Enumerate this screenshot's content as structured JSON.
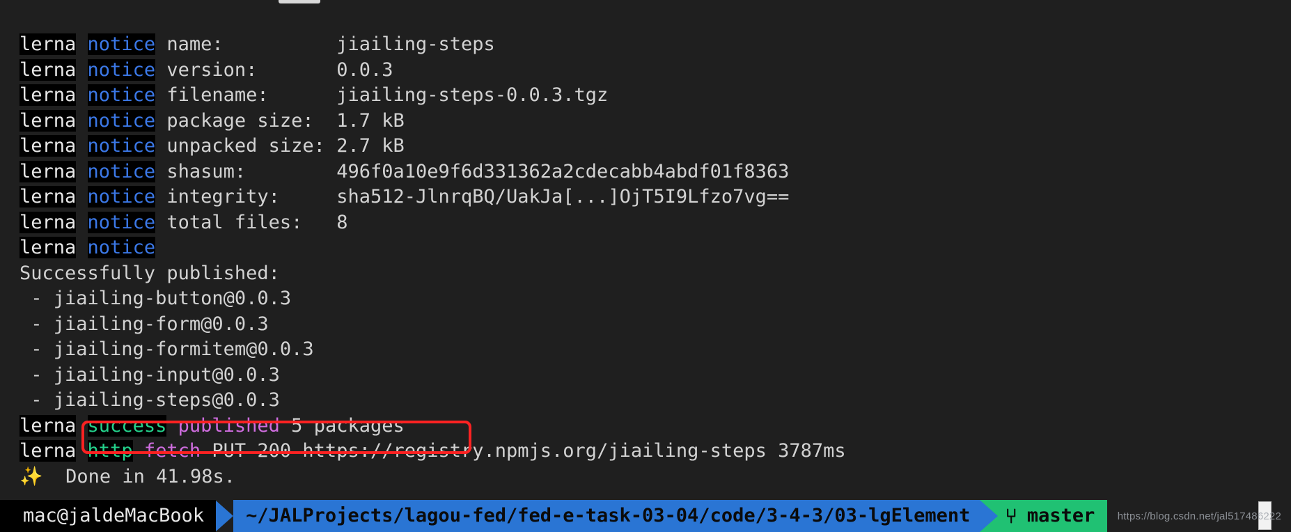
{
  "terminal": {
    "background": "#1f1f1f",
    "foreground": "#d2d2d2",
    "notice_color": "#3b78e7",
    "success_color": "#23d18b",
    "magenta_color": "#cf6ddf",
    "annotation_color": "#fb2222"
  },
  "lines": {
    "l1_tag": "lerna",
    "l1_level": "notice",
    "l1_key": " name:          ",
    "l1_value": "jiailing-steps",
    "l2_tag": "lerna",
    "l2_level": "notice",
    "l2_key": " version:       ",
    "l2_value": "0.0.3",
    "l3_tag": "lerna",
    "l3_level": "notice",
    "l3_key": " filename:      ",
    "l3_value": "jiailing-steps-0.0.3.tgz",
    "l4_tag": "lerna",
    "l4_level": "notice",
    "l4_key": " package size:  ",
    "l4_value": "1.7 kB",
    "l5_tag": "lerna",
    "l5_level": "notice",
    "l5_key": " unpacked size: ",
    "l5_value": "2.7 kB",
    "l6_tag": "lerna",
    "l6_level": "notice",
    "l6_key": " shasum:        ",
    "l6_value": "496f0a10e9f6d331362a2cdecabb4abdf01f8363",
    "l7_tag": "lerna",
    "l7_level": "notice",
    "l7_key": " integrity:     ",
    "l7_value": "sha512-JlnrqBQ/UakJa[...]OjT5I9Lfzo7vg==",
    "l8_tag": "lerna",
    "l8_level": "notice",
    "l8_key": " total files:   ",
    "l8_value": "8",
    "l9_tag": "lerna",
    "l9_level": "notice",
    "l9_value": "",
    "l10_text": "Successfully published:",
    "l11_text": " - jiailing-button@0.0.3",
    "l12_text": " - jiailing-form@0.0.3",
    "l13_text": " - jiailing-formitem@0.0.3",
    "l14_text": " - jiailing-input@0.0.3",
    "l15_text": " - jiailing-steps@0.0.3",
    "l16_tag": "lerna",
    "l16_level": "success",
    "l16_word": "published",
    "l16_rest": " 5 packages",
    "l17_tag": "lerna",
    "l17_level": "http",
    "l17_word": "fetch",
    "l17_rest": " PUT 200 https://registry.npmjs.org/jiailing-steps 3787ms",
    "l18_icon": "✨",
    "l18_text": "  Done in 41.98s."
  },
  "prompt": {
    "user_host": "mac@jaldeMacBook",
    "path": "~/JALProjects/lagou-fed/fed-e-task-03-04/code/3-4-3/03-lgElement",
    "branch_glyph": "⑂",
    "branch": "master",
    "user_bg": "#000000",
    "path_bg": "#2a75d4",
    "git_bg": "#20c173"
  },
  "watermark": {
    "text": "https://blog.csdn.net/jal517486222"
  }
}
